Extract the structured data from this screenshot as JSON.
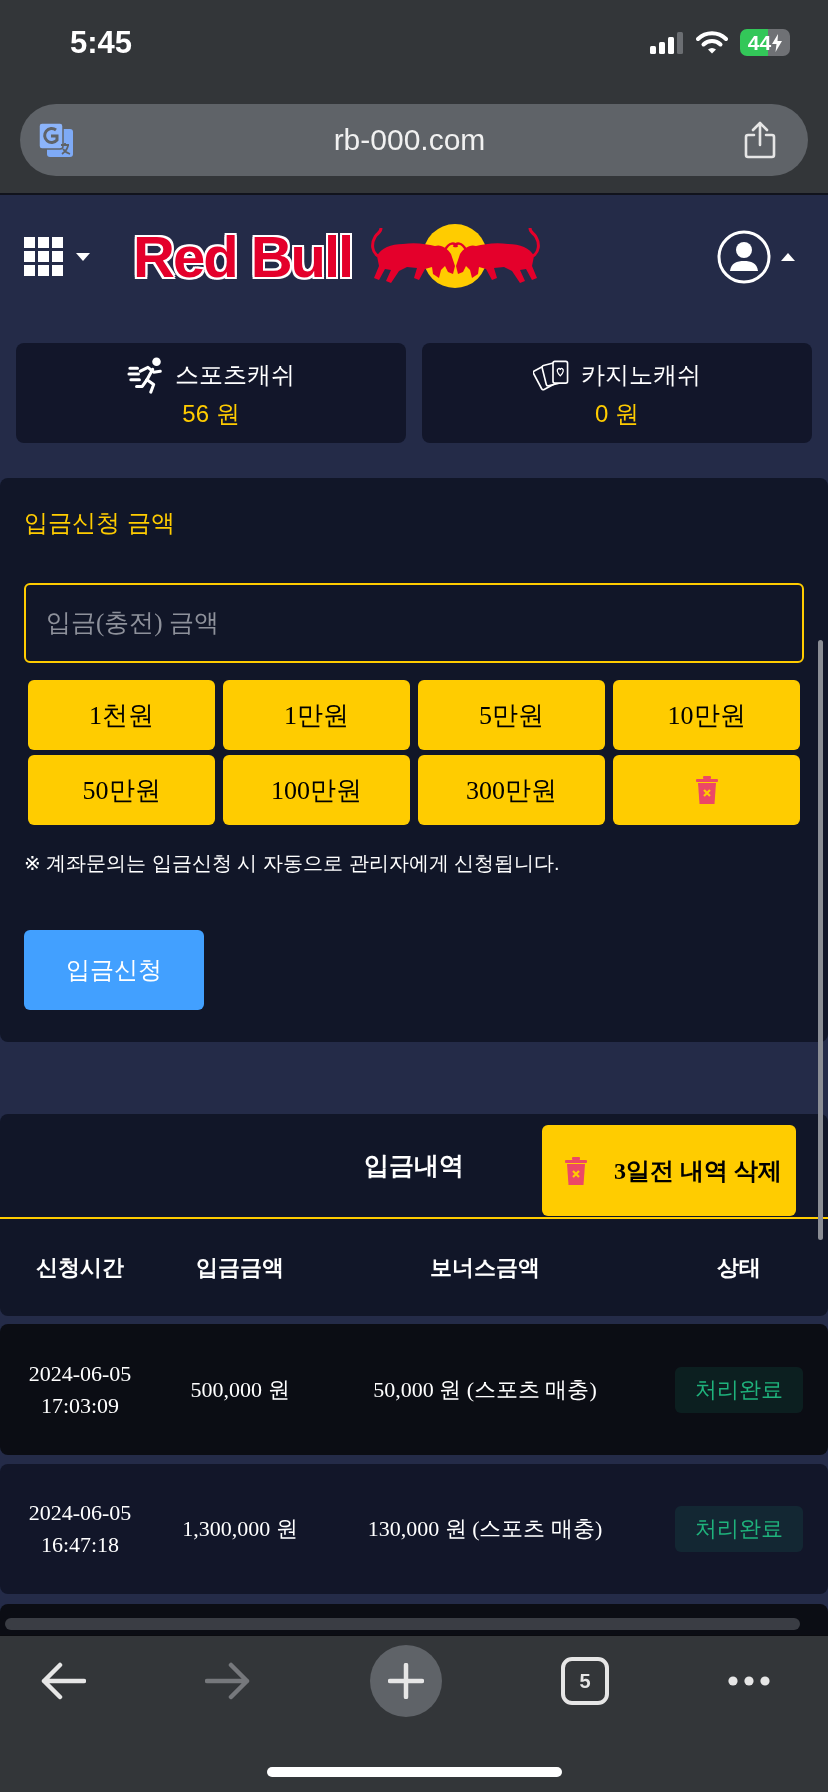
{
  "status_bar": {
    "time": "5:45",
    "battery": "44"
  },
  "browser": {
    "url": "rb-000.com"
  },
  "header": {
    "logo_text": "Red Bull"
  },
  "wallets": [
    {
      "kind": "sports",
      "label": "스포츠캐쉬",
      "amount": "56 원"
    },
    {
      "kind": "casino",
      "label": "카지노캐쉬",
      "amount": "0 원"
    }
  ],
  "deposit": {
    "title": "입금신청 금액",
    "amount_field": {
      "placeholder": "입금(충전) 금액"
    },
    "quick_buttons": [
      {
        "kind": "amount",
        "label": "1천원"
      },
      {
        "kind": "amount",
        "label": "1만원"
      },
      {
        "kind": "amount",
        "label": "5만원"
      },
      {
        "kind": "amount",
        "label": "10만원"
      },
      {
        "kind": "amount",
        "label": "50만원"
      },
      {
        "kind": "amount",
        "label": "100만원"
      },
      {
        "kind": "amount",
        "label": "300만원"
      },
      {
        "kind": "clear"
      }
    ],
    "notice": "※ 계좌문의는 입금신청 시 자동으로 관리자에게 신청됩니다.",
    "submit": "입금신청"
  },
  "history": {
    "title": "입금내역",
    "delete_button": "3일전 내역 삭제",
    "columns": [
      "신청시간",
      "입금금액",
      "보너스금액",
      "상태"
    ],
    "rows": [
      {
        "requested_at": "2024-06-05 17:03:09",
        "amount": "500,000 원",
        "bonus": "50,000 원 (스포츠 매충)",
        "status": "처리완료"
      },
      {
        "requested_at": "2024-06-05 16:47:18",
        "amount": "1,300,000 원",
        "bonus": "130,000 원 (스포츠 매충)",
        "status": "처리완료"
      }
    ]
  },
  "toolbar": {
    "forward_disabled": true,
    "tab_count": "5"
  }
}
